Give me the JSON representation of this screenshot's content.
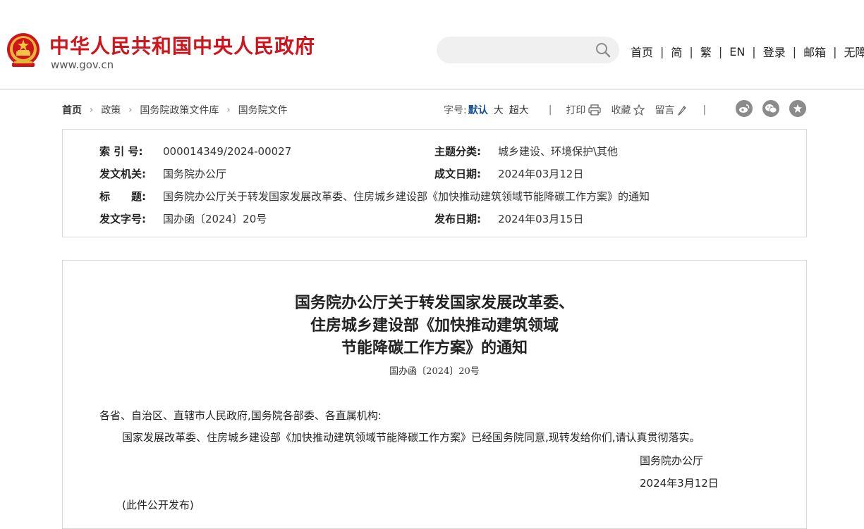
{
  "header": {
    "site_title": "中华人民共和国中央人民政府",
    "site_url": "www.gov.cn",
    "search": {
      "placeholder": ""
    },
    "nav": [
      "首页",
      "简",
      "繁",
      "EN",
      "登录",
      "邮箱",
      "无障碍"
    ],
    "separator": "|"
  },
  "breadcrumb": {
    "items": [
      "首页",
      "政策",
      "国务院政策文件库",
      "国务院文件"
    ],
    "chevron": "›"
  },
  "tools": {
    "font_size_label": "字号:",
    "font_sizes": [
      "默认",
      "大",
      "超大"
    ],
    "active_font_size": "默认",
    "divider": "|",
    "print_label": "打印",
    "favorite_label": "收藏",
    "comment_label": "留言",
    "share_icons": [
      "weibo-icon",
      "wechat-icon",
      "star-icon"
    ]
  },
  "meta": {
    "index_label": "索 引 号:",
    "index_value": "000014349/2024-00027",
    "topic_label": "主题分类:",
    "topic_value": "城乡建设、环境保护\\其他",
    "issuer_label": "发文机关:",
    "issuer_value": "国务院办公厅",
    "created_label": "成文日期:",
    "created_value": "2024年03月12日",
    "title_label": "标　　题:",
    "title_value": "国务院办公厅关于转发国家发展改革委、住房城乡建设部《加快推动建筑领域节能降碳工作方案》的通知",
    "doc_no_label": "发文字号:",
    "doc_no_value": "国办函〔2024〕20号",
    "published_label": "发布日期:",
    "published_value": "2024年03月15日"
  },
  "document": {
    "title_lines": [
      "国务院办公厅关于转发国家发展改革委、",
      "住房城乡建设部《加快推动建筑领域",
      "节能降碳工作方案》的通知"
    ],
    "number": "国办函〔2024〕20号",
    "salutation": "各省、自治区、直辖市人民政府,国务院各部委、各直属机构:",
    "body": "国家发展改革委、住房城乡建设部《加快推动建筑领域节能降碳工作方案》已经国务院同意,现转发给你们,请认真贯彻落实。",
    "signature": "国务院办公厅",
    "date": "2024年3月12日",
    "note": "(此件公开发布)"
  },
  "colors": {
    "brand_red": "#d0141b",
    "link_blue": "#1a4f8f",
    "icon_gray": "#8b8b8b"
  }
}
